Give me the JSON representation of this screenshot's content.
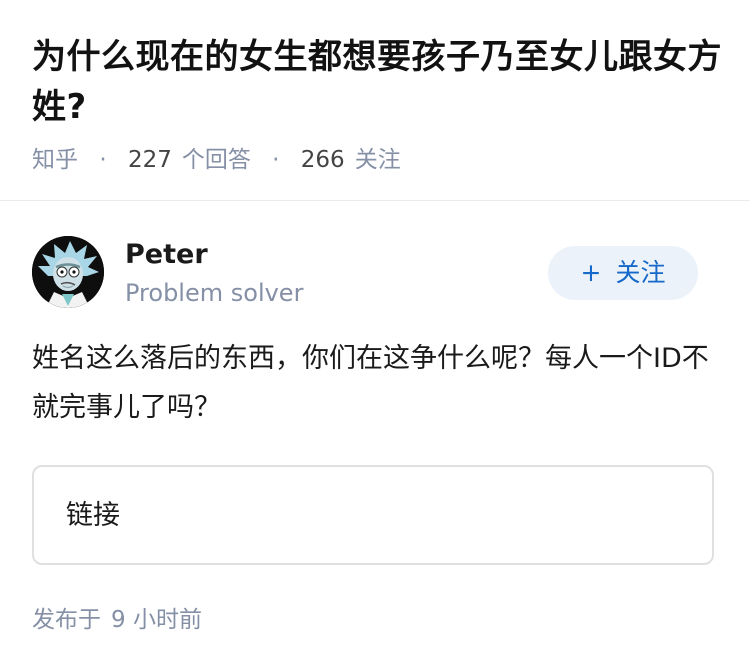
{
  "question": {
    "title": "为什么现在的女生都想要孩子乃至女儿跟女方姓?",
    "source": "知乎",
    "answers_count": "227",
    "answers_label": "个回答",
    "followers_count": "266",
    "followers_label": "关注",
    "separator": "·"
  },
  "answer": {
    "author": {
      "name": "Peter",
      "bio": "Problem solver",
      "avatar_icon": "cartoon-character-avatar"
    },
    "follow_button": {
      "icon": "plus-icon",
      "icon_glyph": "+",
      "label": "关注"
    },
    "content": "姓名这么落后的东西，你们在这争什么呢？每人一个ID不就完事儿了吗？",
    "link_card": {
      "label": "链接"
    },
    "publish_label": "发布于",
    "publish_time": "9 小时前"
  },
  "colors": {
    "meta_gray": "#8590a6",
    "accent_blue": "#1769c9",
    "button_bg": "#ebf2fa",
    "divider": "#ebebeb",
    "card_border": "#e0e0e0"
  }
}
